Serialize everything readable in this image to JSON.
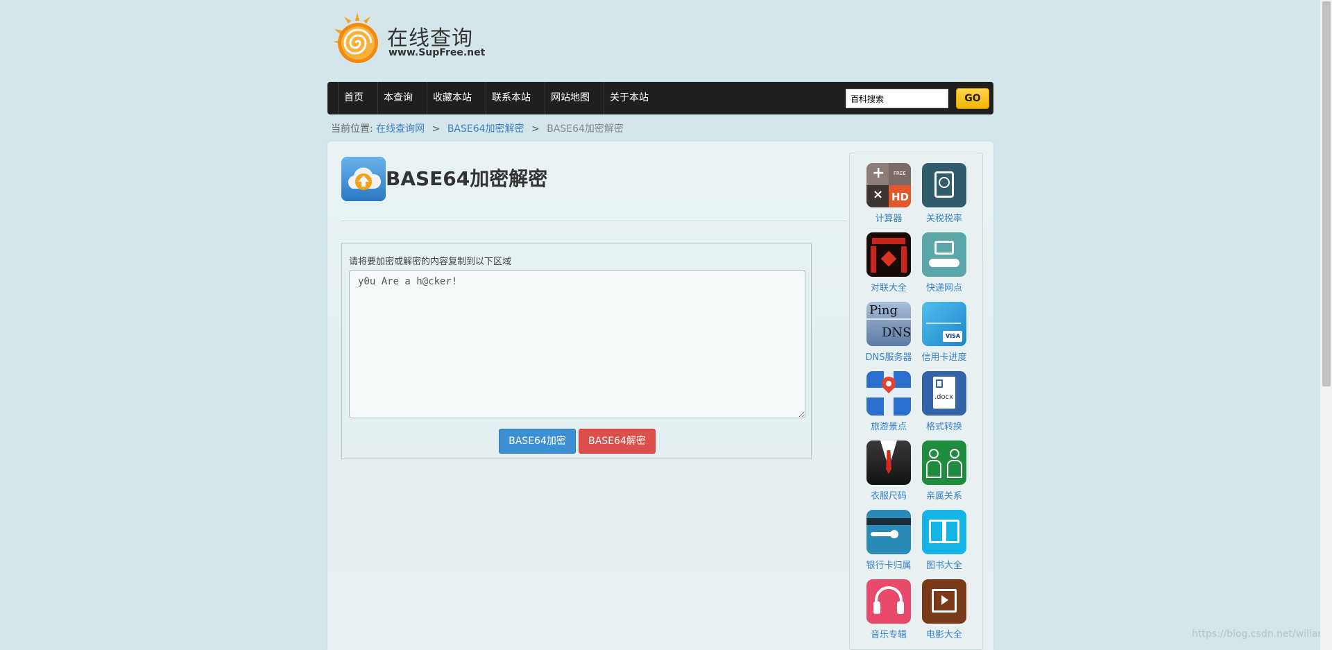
{
  "logo": {
    "title": "在线查询",
    "url": "www.SupFree.net"
  },
  "nav": {
    "items": [
      "首页",
      "本查询",
      "收藏本站",
      "联系本站",
      "网站地图",
      "关于本站"
    ],
    "search_value": "百科搜索",
    "go_label": "GO"
  },
  "breadcrumb": {
    "prefix": "当前位置:",
    "links": [
      "在线查询网",
      "BASE64加密解密"
    ],
    "current": "BASE64加密解密",
    "sep": ">"
  },
  "main": {
    "title": "BASE64加密解密",
    "input_label": "请将要加密或解密的内容复制到以下区域",
    "input_value": "y0u Are a h@cker!",
    "encrypt_label": "BASE64加密",
    "decrypt_label": "BASE64解密"
  },
  "sidebar": {
    "apps": [
      {
        "label": "计算器",
        "icon": "calculator-icon"
      },
      {
        "label": "关税税率",
        "icon": "tax-icon"
      },
      {
        "label": "对联大全",
        "icon": "couplet-icon"
      },
      {
        "label": "快递网点",
        "icon": "delivery-icon"
      },
      {
        "label": "DNS服务器",
        "icon": "dns-icon"
      },
      {
        "label": "信用卡进度",
        "icon": "credit-card-icon"
      },
      {
        "label": "旅游景点",
        "icon": "map-pin-icon"
      },
      {
        "label": "格式转换",
        "icon": "docx-icon"
      },
      {
        "label": "衣服尺码",
        "icon": "suit-icon"
      },
      {
        "label": "亲属关系",
        "icon": "family-icon"
      },
      {
        "label": "银行卡归属",
        "icon": "bank-card-icon"
      },
      {
        "label": "图书大全",
        "icon": "book-icon"
      },
      {
        "label": "音乐专辑",
        "icon": "headphones-icon"
      },
      {
        "label": "电影大全",
        "icon": "film-icon"
      }
    ]
  },
  "watermark": "https://blog.csdn.net/wiliam",
  "colors": {
    "nav_bg": "#1f1f1f",
    "link": "#3a82c6",
    "encrypt": "#3d8fd4",
    "decrypt": "#dd4f4a",
    "go": "#f6b400"
  }
}
